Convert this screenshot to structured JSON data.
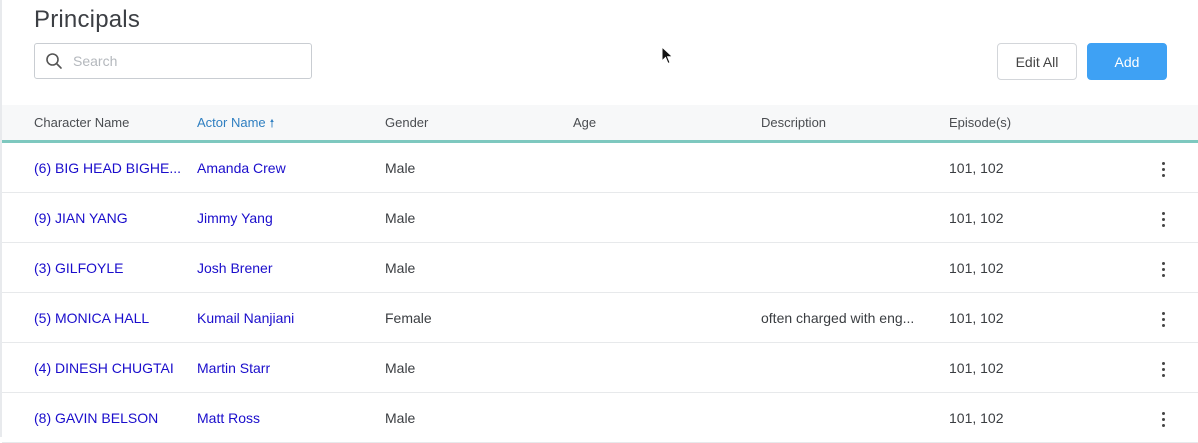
{
  "page": {
    "title": "Principals"
  },
  "search": {
    "placeholder": "Search"
  },
  "toolbar": {
    "edit_all_label": "Edit All",
    "add_label": "Add"
  },
  "table": {
    "columns": [
      {
        "label": "Character Name",
        "sorted": false
      },
      {
        "label": "Actor Name",
        "sorted": true,
        "sort_dir": "ascending"
      },
      {
        "label": "Gender",
        "sorted": false
      },
      {
        "label": "Age",
        "sorted": false
      },
      {
        "label": "Description",
        "sorted": false
      },
      {
        "label": "Episode(s)",
        "sorted": false
      }
    ],
    "sort_arrow": "🠕",
    "rows": [
      {
        "character": "(6) BIG HEAD BIGHE...",
        "actor": "Amanda Crew",
        "gender": "Male",
        "age": "",
        "description": "",
        "episodes": "101, 102"
      },
      {
        "character": "(9) JIAN YANG",
        "actor": "Jimmy Yang",
        "gender": "Male",
        "age": "",
        "description": "",
        "episodes": "101, 102"
      },
      {
        "character": "(3) GILFOYLE",
        "actor": "Josh Brener",
        "gender": "Male",
        "age": "",
        "description": "",
        "episodes": "101, 102"
      },
      {
        "character": "(5) MONICA HALL",
        "actor": "Kumail Nanjiani",
        "gender": "Female",
        "age": "",
        "description": "often charged with eng...",
        "episodes": "101, 102"
      },
      {
        "character": "(4) DINESH CHUGTAI",
        "actor": "Martin Starr",
        "gender": "Male",
        "age": "",
        "description": "",
        "episodes": "101, 102"
      },
      {
        "character": "(8) GAVIN BELSON",
        "actor": "Matt Ross",
        "gender": "Male",
        "age": "",
        "description": "",
        "episodes": "101, 102"
      }
    ]
  },
  "colors": {
    "accent": "#3ea1f4",
    "header_underline": "#7ec8bf",
    "link": "#1a0dcc",
    "sorted_header": "#2f7fc1"
  }
}
